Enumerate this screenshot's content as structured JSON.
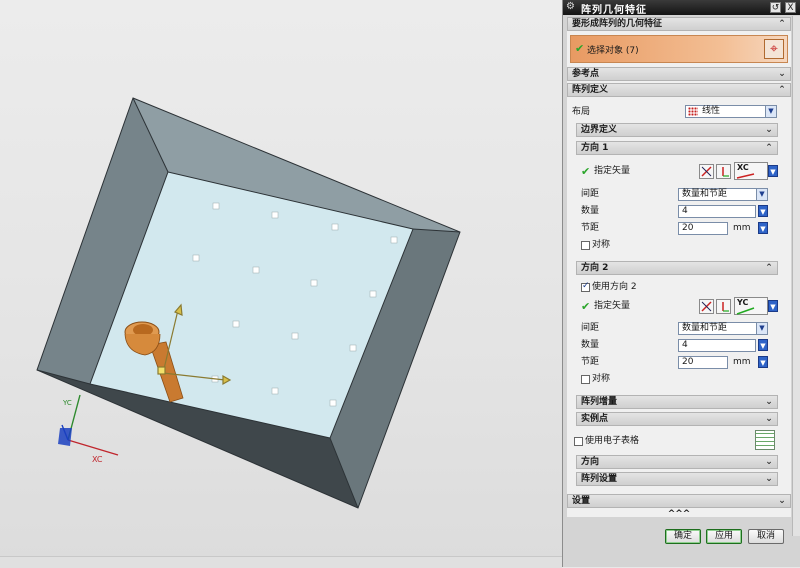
{
  "dialog": {
    "title": "阵列几何特征",
    "restore_label": "↺",
    "close_label": "X",
    "geom_section": "要形成阵列的几何特征",
    "select_object": "选择对象 (7)",
    "ref_point": "参考点",
    "array_def": "阵列定义",
    "layout_label": "布局",
    "layout_value": "线性",
    "boundary": "边界定义",
    "dir1": {
      "title": "方向 1",
      "vector_label": "指定矢量",
      "axis": "XC",
      "spacing_label": "间距",
      "spacing_value": "数量和节距",
      "count_label": "数量",
      "count_value": "4",
      "pitch_label": "节距",
      "pitch_value": "20",
      "unit": "mm",
      "symmetric_label": "对称"
    },
    "dir2": {
      "title": "方向 2",
      "use_dir2": "使用方向 2",
      "vector_label": "指定矢量",
      "axis": "YC",
      "spacing_label": "间距",
      "spacing_value": "数量和节距",
      "count_label": "数量",
      "count_value": "4",
      "pitch_label": "节距",
      "pitch_value": "20",
      "unit": "mm",
      "symmetric_label": "对称"
    },
    "array_increment": "阵列增量",
    "instance_point": "实例点",
    "use_spreadsheet": "使用电子表格",
    "orientation": "方向",
    "array_settings": "阵列设置",
    "settings": "设置",
    "more": "^^^",
    "ok": "确定",
    "apply": "应用",
    "cancel": "取消"
  },
  "viewport": {
    "axis_x": "XC",
    "axis_y": "YC"
  },
  "colors": {
    "selection_bar": "#f0b07a",
    "box_wall": "#6f7c82",
    "floor": "#d3e9ef",
    "part": "#d68a3c"
  }
}
